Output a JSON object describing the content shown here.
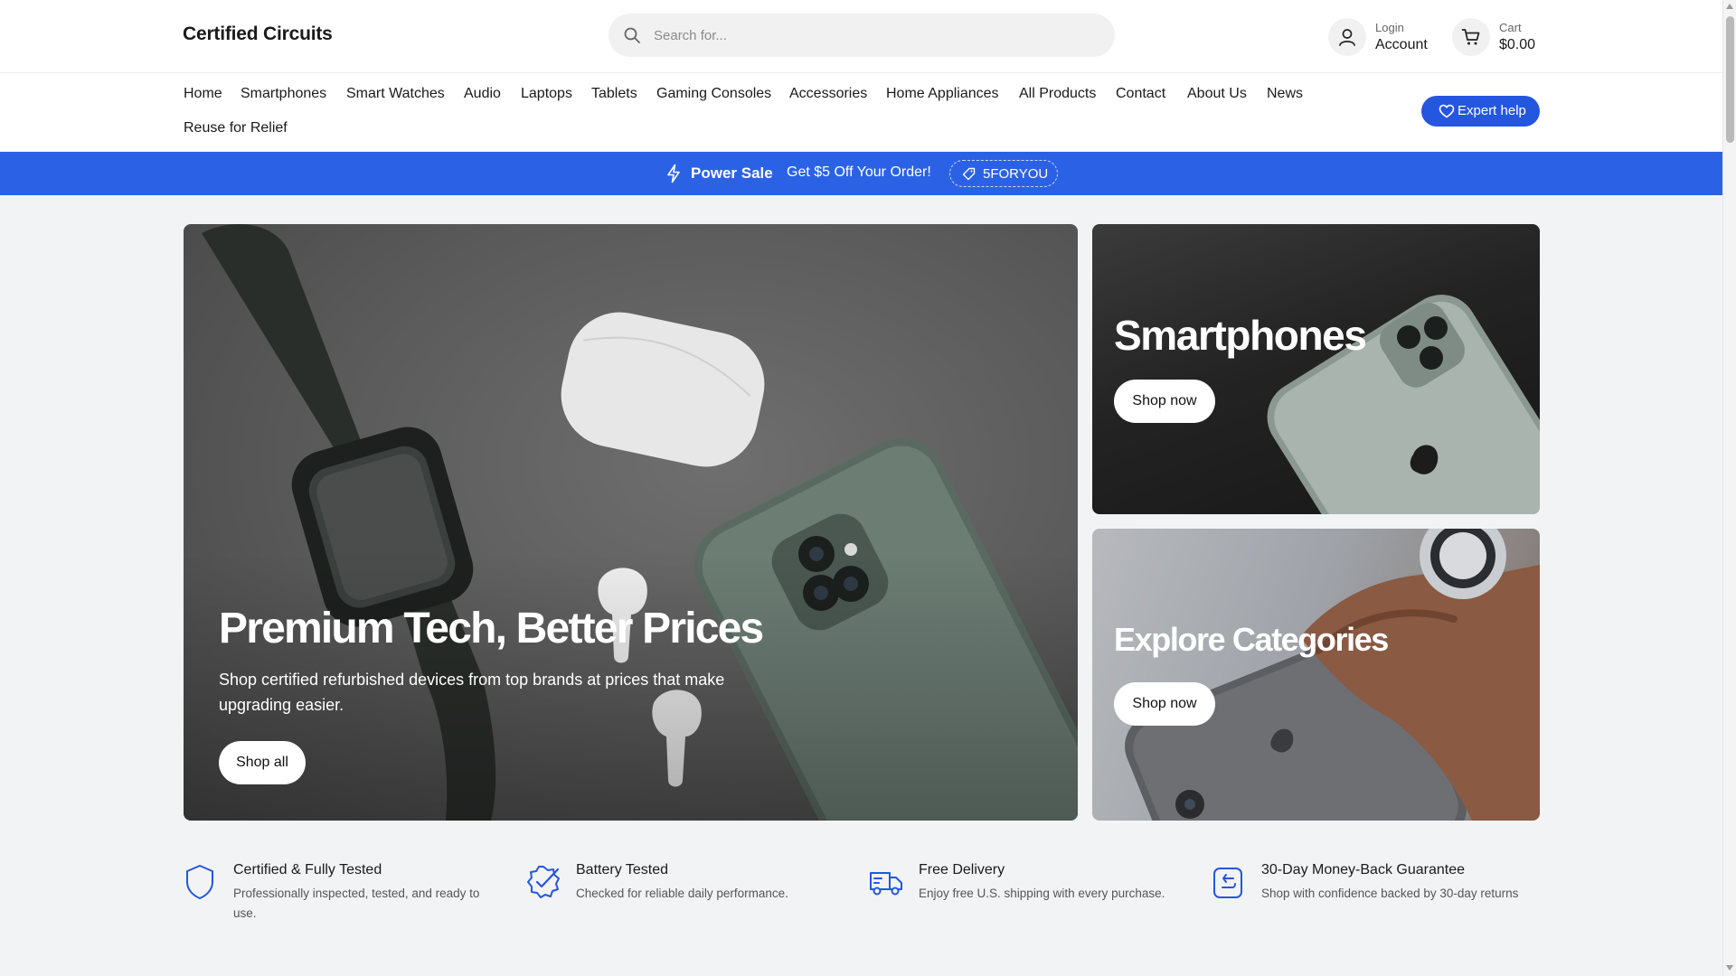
{
  "header": {
    "logo": "Certified Circuits",
    "search_placeholder": "Search for...",
    "account_small": "Login",
    "account_big": "Account",
    "cart_small": "Cart",
    "cart_total": "$0.00"
  },
  "nav": {
    "items": [
      "Home",
      "Smartphones",
      "Smart Watches",
      "Audio",
      "Laptops",
      "Tablets",
      "Gaming Consoles",
      "Accessories",
      "Home Appliances",
      "All Products",
      "Contact",
      "About Us",
      "News",
      "Reuse for Relief"
    ],
    "expert_help": "Expert help"
  },
  "promo": {
    "title": "Power Sale",
    "text": "Get $5 Off Your Order!",
    "code": "5FORYOU"
  },
  "hero": {
    "title": "Premium Tech, Better Prices",
    "subtitle": "Shop certified refurbished devices from top brands at prices that make upgrading easier.",
    "cta": "Shop all"
  },
  "tiles": [
    {
      "title": "Smartphones",
      "cta": "Shop now"
    },
    {
      "title": "Explore Categories",
      "cta": "Shop now"
    }
  ],
  "features": [
    {
      "icon": "shield-icon",
      "title": "Certified & Fully Tested",
      "desc": "Professionally inspected, tested, and ready to use."
    },
    {
      "icon": "badge-check-icon",
      "title": "Battery Tested",
      "desc": "Checked for reliable daily performance."
    },
    {
      "icon": "truck-icon",
      "title": "Free Delivery",
      "desc": "Enjoy free U.S. shipping with every purchase."
    },
    {
      "icon": "return-icon",
      "title": "30-Day Money-Back Guarantee",
      "desc": "Shop with confidence backed by 30-day returns"
    }
  ],
  "colors": {
    "accent": "#2556e0",
    "promo_bar": "#2b62e5",
    "page_bg": "#f2f3f5"
  }
}
